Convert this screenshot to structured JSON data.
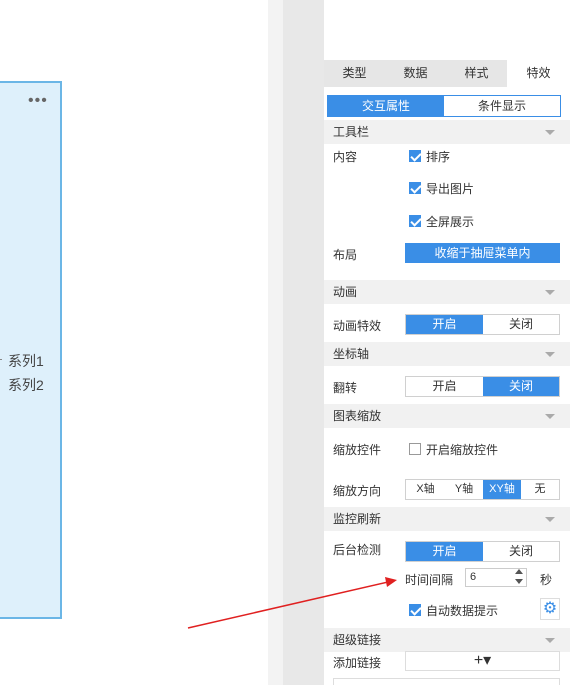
{
  "canvas": {
    "more_icon": "•••",
    "legend": [
      "系列1",
      "系列2"
    ]
  },
  "tabs": [
    "类型",
    "数据",
    "样式",
    "特效"
  ],
  "active_tab": "特效",
  "subtabs": [
    "交互属性",
    "条件显示"
  ],
  "toolbar_section": {
    "title": "工具栏",
    "content_label": "内容",
    "options": [
      {
        "label": "排序",
        "checked": true
      },
      {
        "label": "导出图片",
        "checked": true
      },
      {
        "label": "全屏展示",
        "checked": true
      }
    ],
    "layout_label": "布局",
    "layout_value": "收缩于抽屉菜单内"
  },
  "animation_section": {
    "title": "动画",
    "effect_label": "动画特效",
    "on": "开启",
    "off": "关闭",
    "selected": "开启"
  },
  "axis_section": {
    "title": "坐标轴",
    "flip_label": "翻转",
    "on": "开启",
    "off": "关闭",
    "selected": "关闭"
  },
  "zoom_section": {
    "title": "图表缩放",
    "control_label": "缩放控件",
    "control_checkbox": "开启缩放控件",
    "control_checked": false,
    "direction_label": "缩放方向",
    "directions": [
      "X轴",
      "Y轴",
      "XY轴",
      "无"
    ],
    "selected": "XY轴"
  },
  "monitor_section": {
    "title": "监控刷新",
    "background_label": "后台检测",
    "on": "开启",
    "off": "关闭",
    "selected": "开启",
    "interval_label": "时间间隔",
    "interval_value": "6",
    "interval_unit": "秒",
    "auto_tip_label": "自动数据提示",
    "auto_tip_checked": true
  },
  "hyperlink_section": {
    "title": "超级链接",
    "add_label": "添加链接",
    "add_button": "+▾"
  },
  "colors": {
    "accent": "#3a8ee6",
    "arrow": "#e02020"
  }
}
